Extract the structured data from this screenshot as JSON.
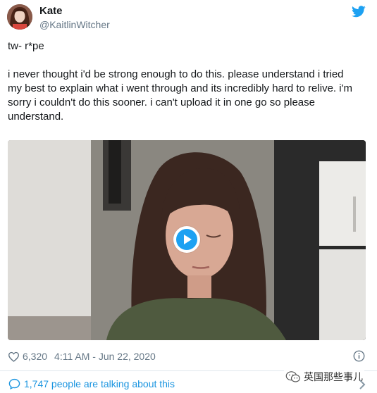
{
  "header": {
    "display_name": "Kate",
    "handle": "@KaitlinWitcher"
  },
  "tweet": {
    "line1": "tw- r*pe",
    "body": "i never thought i'd be strong enough to do this. please understand i tried my best to explain what i went through and its incredibly hard to relive. i'm sorry i couldn't do this sooner. i can't upload it in one go so please understand."
  },
  "meta": {
    "likes": "6,320",
    "timestamp": "4:11 AM - Jun 22, 2020"
  },
  "conversation": {
    "label": "1,747 people are talking about this"
  },
  "watermark": {
    "text": "英国那些事儿"
  },
  "icons": {
    "twitter": "twitter-bird-icon",
    "like": "heart-icon",
    "info": "info-icon",
    "conversation": "speech-bubble-icon",
    "chevron": "chevron-right-icon",
    "play": "play-icon"
  },
  "colors": {
    "accent": "#1da1f2",
    "link": "#1b95e0",
    "secondary_text": "#657786"
  }
}
